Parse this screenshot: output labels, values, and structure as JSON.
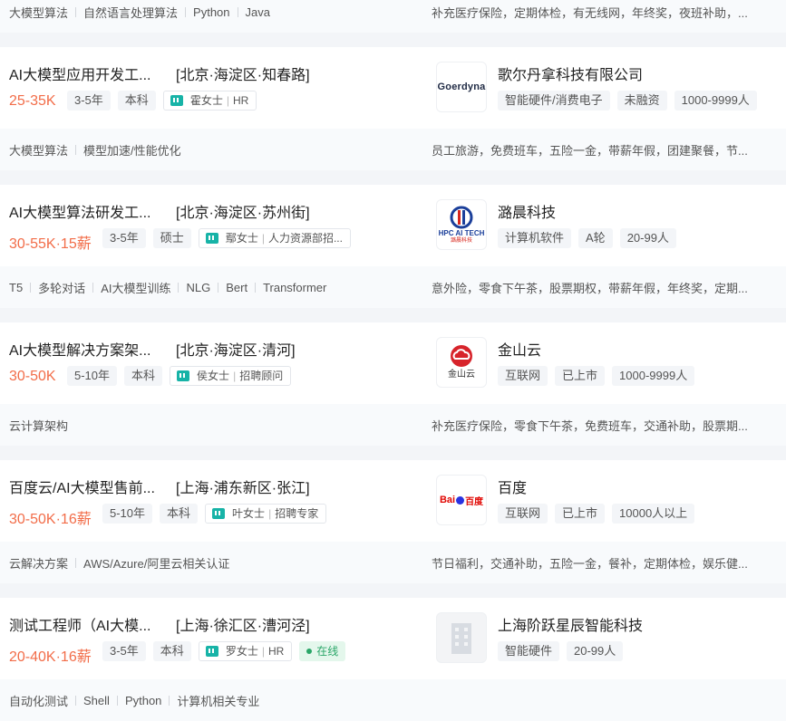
{
  "cards": [
    {
      "partial": true,
      "skills": [
        "大模型算法",
        "自然语言处理算法",
        "Python",
        "Java"
      ],
      "welfare": "补充医疗保险，定期体检，有无线网，年终奖，夜班补助，..."
    },
    {
      "title": "AI大模型应用开发工...",
      "area": "[北京·海淀区·知春路]",
      "salary": "25-35K",
      "experience": "3-5年",
      "degree": "本科",
      "hr": {
        "name": "霍女士",
        "role": "HR"
      },
      "company": "歌尔丹拿科技有限公司",
      "company_tags": [
        "智能硬件/消费电子",
        "未融资",
        "1000-9999人"
      ],
      "logo": {
        "type": "text",
        "text": "Goerdyna",
        "icon": "goerdyna-logo"
      },
      "skills": [
        "大模型算法",
        "模型加速/性能优化"
      ],
      "welfare": "员工旅游，免费班车，五险一金，带薪年假，团建聚餐，节..."
    },
    {
      "title": "AI大模型算法研发工...",
      "area": "[北京·海淀区·苏州街]",
      "salary": "30-55K·15薪",
      "experience": "3-5年",
      "degree": "硕士",
      "hr": {
        "name": "鄢女士",
        "role": "人力资源部招..."
      },
      "company": "潞晨科技",
      "company_tags": [
        "计算机软件",
        "A轮",
        "20-99人"
      ],
      "logo": {
        "type": "hpc",
        "text": "HPC AI TECH",
        "sub": "潞晨科技",
        "icon": "hpc-ai-tech-logo"
      },
      "skills": [
        "T5",
        "多轮对话",
        "AI大模型训练",
        "NLG",
        "Bert",
        "Transformer"
      ],
      "welfare": "意外险，零食下午茶，股票期权，带薪年假，年终奖，定期..."
    },
    {
      "title": "AI大模型解决方案架...",
      "area": "[北京·海淀区·清河]",
      "salary": "30-50K",
      "experience": "5-10年",
      "degree": "本科",
      "hr": {
        "name": "侯女士",
        "role": "招聘顾问"
      },
      "company": "金山云",
      "company_tags": [
        "互联网",
        "已上市",
        "1000-9999人"
      ],
      "logo": {
        "type": "kingsoft",
        "text": "金山云",
        "icon": "kingsoft-cloud-logo"
      },
      "skills": [
        "云计算架构"
      ],
      "welfare": "补充医疗保险，零食下午茶，免费班车，交通补助，股票期..."
    },
    {
      "title": "百度云/AI大模型售前...",
      "area": "[上海·浦东新区·张江]",
      "salary": "30-50K·16薪",
      "experience": "5-10年",
      "degree": "本科",
      "hr": {
        "name": "叶女士",
        "role": "招聘专家"
      },
      "company": "百度",
      "company_tags": [
        "互联网",
        "已上市",
        "10000人以上"
      ],
      "logo": {
        "type": "baidu",
        "text_left": "Bai",
        "text_right": "百度",
        "icon": "baidu-logo"
      },
      "skills": [
        "云解决方案",
        "AWS/Azure/阿里云相关认证"
      ],
      "welfare": "节日福利，交通补助，五险一金，餐补，定期体检，娱乐健..."
    },
    {
      "title": "测试工程师（AI大模...",
      "area": "[上海·徐汇区·漕河泾]",
      "salary": "20-40K·16薪",
      "experience": "3-5年",
      "degree": "本科",
      "hr": {
        "name": "罗女士",
        "role": "HR"
      },
      "online": "在线",
      "company": "上海阶跃星辰智能科技",
      "company_tags": [
        "智能硬件",
        "20-99人"
      ],
      "logo": {
        "type": "building",
        "icon": "building-placeholder-icon"
      },
      "skills": [
        "自动化测试",
        "Shell",
        "Python",
        "计算机相关专业"
      ],
      "welfare": ""
    }
  ],
  "colors": {
    "salary": "#f26d49",
    "hr_icon": "#17b3a7",
    "online": "#2aa668",
    "hpc_blue": "#1b3f9a",
    "hpc_red": "#d8261c",
    "kingsoft_red": "#d7242b",
    "baidu_red": "#e10602",
    "baidu_blue": "#2932e1"
  }
}
